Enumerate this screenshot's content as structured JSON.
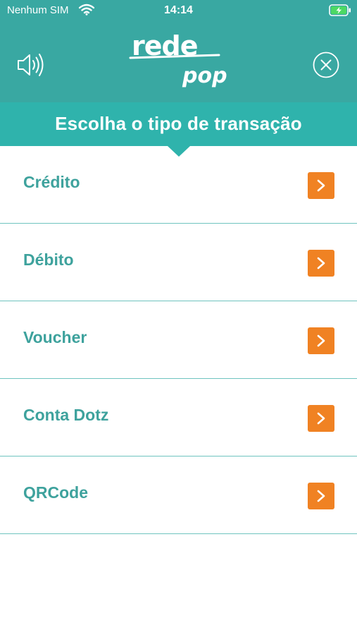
{
  "status_bar": {
    "carrier": "Nenhum SIM",
    "time": "14:14",
    "wifi_icon": "wifi-icon",
    "battery_icon": "battery-charging-icon"
  },
  "header": {
    "logo_text_top": "rede",
    "logo_text_bottom": "pop",
    "speaker_icon": "speaker-icon",
    "close_icon": "close-circle-icon"
  },
  "title": "Escolha o tipo de transação",
  "options": [
    {
      "label": "Crédito"
    },
    {
      "label": "Débito"
    },
    {
      "label": "Voucher"
    },
    {
      "label": "Conta Dotz"
    },
    {
      "label": "QRCode"
    }
  ],
  "colors": {
    "header": "#39a8a2",
    "title_band": "#2fb3ac",
    "option_text": "#3ea29d",
    "arrow_button": "#f08223",
    "divider": "#6fc4bf"
  }
}
